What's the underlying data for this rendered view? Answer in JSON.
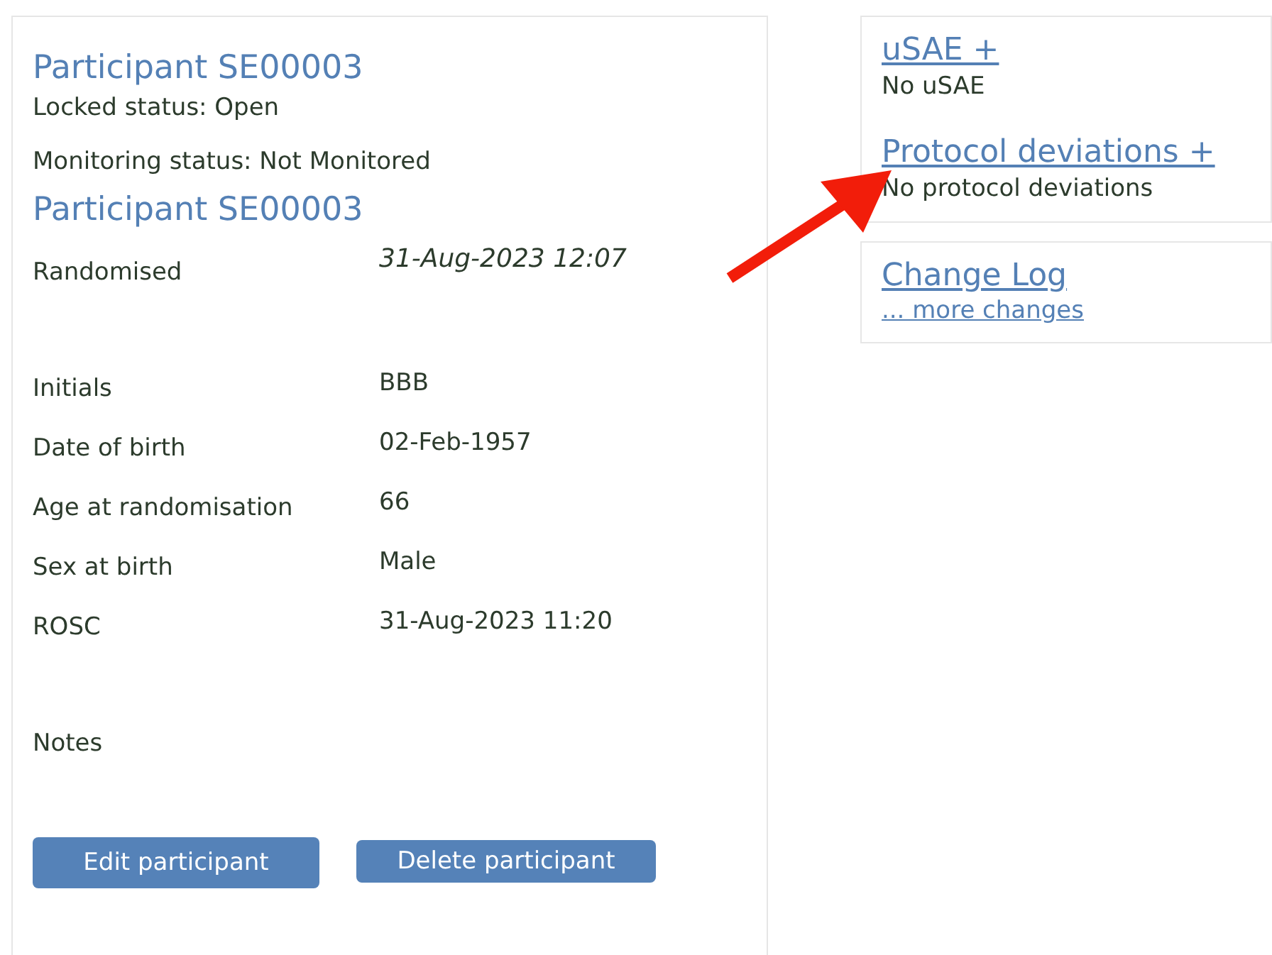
{
  "participant": {
    "title": "Participant SE00003",
    "locked_status": "Locked status: Open",
    "monitoring_status": "Monitoring status: Not Monitored",
    "subtitle": "Participant SE00003",
    "field_groups": [
      [
        {
          "label": "Randomised",
          "value": "31-Aug-2023 12:07",
          "italic": true
        }
      ],
      [
        {
          "label": "Initials",
          "value": "BBB",
          "italic": false
        },
        {
          "label": "Date of birth",
          "value": "02-Feb-1957",
          "italic": false
        },
        {
          "label": "Age at randomisation",
          "value": "66",
          "italic": false
        },
        {
          "label": "Sex at birth",
          "value": "Male",
          "italic": false
        },
        {
          "label": "ROSC",
          "value": "31-Aug-2023 11:20",
          "italic": false
        }
      ],
      [
        {
          "label": "Notes"
        }
      ]
    ],
    "buttons": [
      "Edit participant",
      "Delete participant"
    ]
  },
  "side_panels": [
    {
      "sections": [
        {
          "link": "uSAE +",
          "text": "No uSAE"
        },
        {
          "link": "Protocol deviations +",
          "text": "No protocol deviations"
        }
      ]
    },
    {
      "sections": [
        {
          "link": "Change Log",
          "sublink": "... more changes"
        }
      ]
    }
  ]
}
